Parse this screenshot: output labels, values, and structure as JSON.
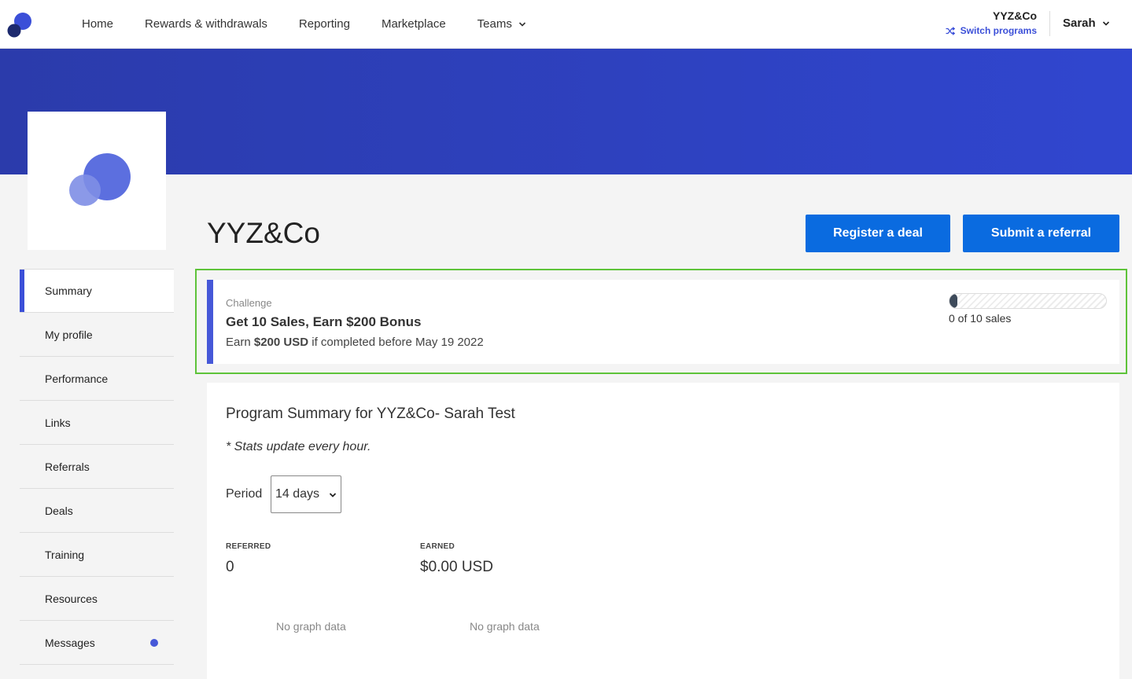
{
  "nav": {
    "items": [
      {
        "label": "Home"
      },
      {
        "label": "Rewards & withdrawals"
      },
      {
        "label": "Reporting"
      },
      {
        "label": "Marketplace"
      },
      {
        "label": "Teams"
      }
    ],
    "org_name": "YYZ&Co",
    "switch_label": "Switch programs",
    "user_name": "Sarah"
  },
  "program": {
    "title": "YYZ&Co",
    "register_deal_label": "Register a deal",
    "submit_referral_label": "Submit a referral"
  },
  "sidebar": {
    "items": [
      {
        "label": "Summary"
      },
      {
        "label": "My profile"
      },
      {
        "label": "Performance"
      },
      {
        "label": "Links"
      },
      {
        "label": "Referrals"
      },
      {
        "label": "Deals"
      },
      {
        "label": "Training"
      },
      {
        "label": "Resources"
      },
      {
        "label": "Messages"
      }
    ]
  },
  "challenge": {
    "tag": "Challenge",
    "title": "Get 10 Sales, Earn $200 Bonus",
    "desc_prefix": "Earn ",
    "desc_amount": "$200 USD",
    "desc_suffix": " if completed before May 19 2022",
    "progress_label": "0 of 10 sales",
    "progress_value": 0,
    "progress_total": 10
  },
  "summary": {
    "title": "Program Summary for YYZ&Co- Sarah Test",
    "note": "* Stats update every hour.",
    "period_label": "Period",
    "period_value": "14 days",
    "referred_label": "REFERRED",
    "referred_value": "0",
    "earned_label": "EARNED",
    "earned_value": "$0.00 USD",
    "no_graph_1": "No graph data",
    "no_graph_2": "No graph data"
  },
  "colors": {
    "accent": "#3b4fd8",
    "button": "#0a6be0",
    "banner": "#2f44c8",
    "highlight": "#5ec33a"
  }
}
